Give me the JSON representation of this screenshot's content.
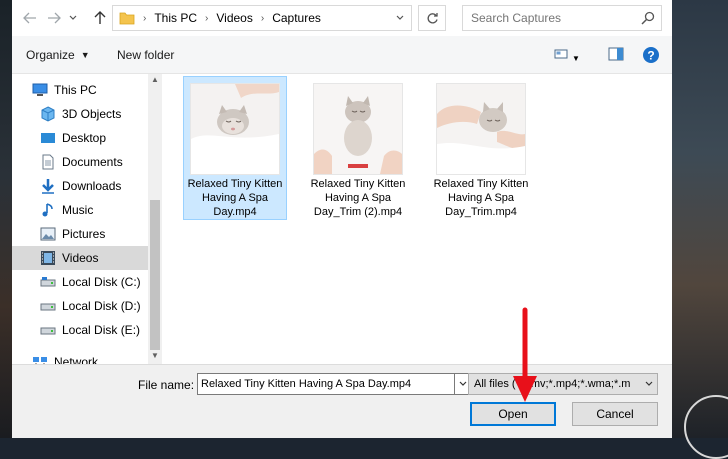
{
  "address_bar": {
    "path": [
      "This PC",
      "Videos",
      "Captures"
    ],
    "search_placeholder": "Search Captures",
    "icons": {
      "back": "arrow-left-icon",
      "forward": "arrow-right-icon",
      "recent": "chevron-down-icon",
      "up": "arrow-up-icon",
      "refresh": "refresh-icon",
      "search": "search-icon"
    }
  },
  "toolbar": {
    "organize_label": "Organize",
    "new_folder_label": "New folder"
  },
  "nav_pane": {
    "items": [
      {
        "label": "This PC",
        "icon": "this-pc-icon"
      },
      {
        "label": "3D Objects",
        "icon": "3d-objects-icon"
      },
      {
        "label": "Desktop",
        "icon": "desktop-icon"
      },
      {
        "label": "Documents",
        "icon": "documents-icon"
      },
      {
        "label": "Downloads",
        "icon": "downloads-icon"
      },
      {
        "label": "Music",
        "icon": "music-icon"
      },
      {
        "label": "Pictures",
        "icon": "pictures-icon"
      },
      {
        "label": "Videos",
        "icon": "videos-icon",
        "selected": true
      },
      {
        "label": "Local Disk (C:)",
        "icon": "drive-icon"
      },
      {
        "label": "Local Disk (D:)",
        "icon": "drive-icon"
      },
      {
        "label": "Local Disk (E:)",
        "icon": "drive-icon"
      },
      {
        "label": "Network",
        "icon": "network-icon"
      }
    ]
  },
  "files": [
    {
      "name": "Relaxed Tiny Kitten Having A Spa Day.mp4",
      "selected": true
    },
    {
      "name": "Relaxed Tiny Kitten Having A Spa Day_Trim (2).mp4",
      "selected": false
    },
    {
      "name": "Relaxed Tiny Kitten Having A Spa Day_Trim.mp4",
      "selected": false
    }
  ],
  "bottom": {
    "file_name_label": "File name:",
    "file_name_value": "Relaxed Tiny Kitten Having A Spa Day.mp4",
    "file_type_value": "All files (*.wmv;*.mp4;*.wma;*.m",
    "open_label": "Open",
    "cancel_label": "Cancel"
  },
  "colors": {
    "selection": "#cce8ff",
    "selection_border": "#99d1ff",
    "accent": "#0078d7",
    "annotation_arrow": "#e8101a"
  }
}
